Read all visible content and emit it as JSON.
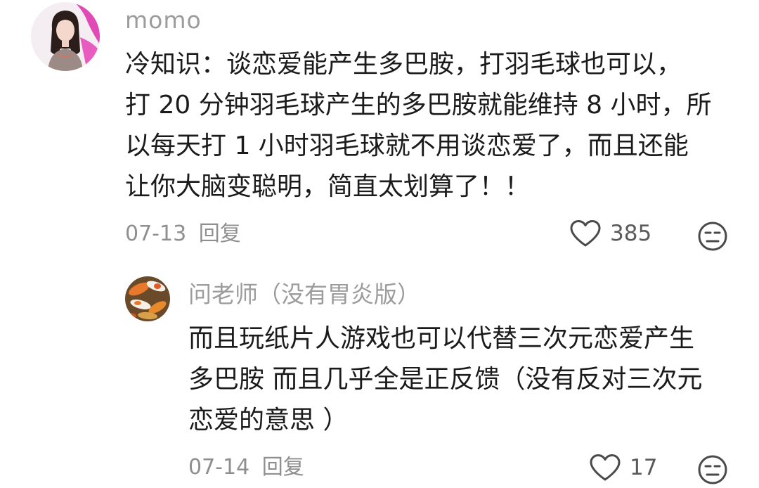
{
  "comments": [
    {
      "username": "momo",
      "lines": [
        "冷知识：谈恋爱能产生多巴胺，打羽毛球也可以，",
        "打 20 分钟羽毛球产生的多巴胺就能维持 8 小时，所",
        "以每天打 1 小时羽毛球就不用谈恋爱了，而且还能",
        "让你大脑变聪明，简直太划算了！！"
      ],
      "date": "07-13",
      "reply_label": "回复",
      "likes": "385",
      "avatar_icon": "user-avatar-girl"
    },
    {
      "username": "问老师（没有胃炎版）",
      "lines": [
        "而且玩纸片人游戏也可以代替三次元恋爱产生",
        "多巴胺 而且几乎全是正反馈（没有反对三次元",
        "恋爱的意思 ）"
      ],
      "date": "07-14",
      "reply_label": "回复",
      "likes": "17",
      "avatar_icon": "user-avatar-koi-fish"
    }
  ],
  "icons": {
    "like": "heart-outline-icon",
    "dislike": "unamused-face-icon"
  },
  "colors": {
    "username": "#9c9c9c",
    "body": "#1b1b1b",
    "meta": "#8f8f8f",
    "icon_stroke": "#4a4a4a"
  }
}
